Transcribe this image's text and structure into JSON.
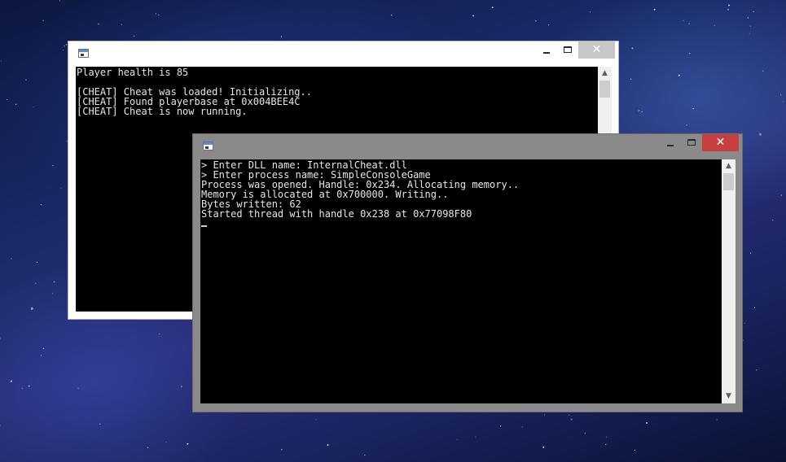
{
  "background_window": {
    "title": "",
    "icon": "console-app-icon",
    "controls": {
      "minimize_icon": "minimize-icon",
      "maximize_icon": "maximize-icon",
      "close_glyph": "✕"
    },
    "console_lines": [
      "Player health is 85",
      "",
      "[CHEAT] Cheat was loaded! Initializing..",
      "[CHEAT] Found playerbase at 0x004BEE4C",
      "[CHEAT] Cheat is now running."
    ],
    "scrollbar": {
      "up_arrow": "▲",
      "down_arrow": "▼"
    }
  },
  "foreground_window": {
    "title": "",
    "icon": "console-app-icon",
    "controls": {
      "minimize_icon": "minimize-icon",
      "maximize_icon": "maximize-icon",
      "close_glyph": "✕"
    },
    "console_lines": [
      "> Enter DLL name: InternalCheat.dll",
      "> Enter process name: SimpleConsoleGame",
      "Process was opened. Handle: 0x234. Allocating memory..",
      "Memory is allocated at 0x700000. Writing..",
      "Bytes written: 62",
      "Started thread with handle 0x238 at 0x77098F80"
    ],
    "scrollbar": {
      "up_arrow": "▲",
      "down_arrow": "▼"
    }
  },
  "colors": {
    "console_background": "#000000",
    "console_text": "#e6e6e6",
    "close_button_active": "#c74040",
    "inactive_titlebar": "#ffffff",
    "active_titlebar": "#8a8a8a"
  }
}
